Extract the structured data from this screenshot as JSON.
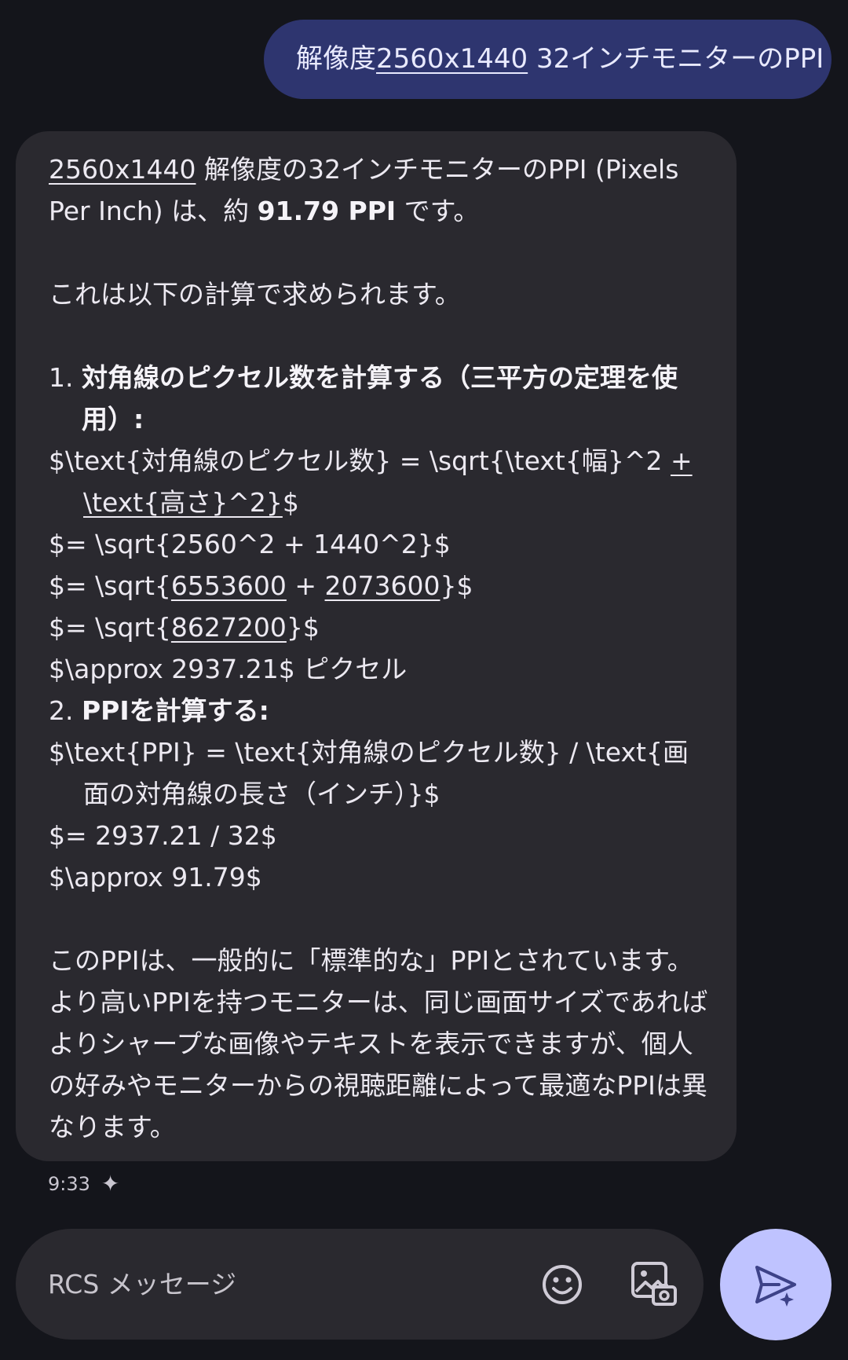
{
  "user_message": {
    "prefix": "解像度",
    "link": "2560x1440",
    "suffix": " 32インチモニターのPPI"
  },
  "ai_message": {
    "intro_link": "2560x1440",
    "intro_text1": " 解像度の32インチモニターのPPI (Pixels Per Inch) は、約 ",
    "intro_bold": "91.79 PPI",
    "intro_text2": " です。",
    "calc_intro": "これは以下の計算で求められます。",
    "step1_num": "1.",
    "step1_title": "対角線のピクセル数を計算する（三平方の定理を使用）:",
    "f1_a": "$\\text{対角線のピクセル数} = \\sqrt{\\text{幅}^2 ",
    "f1_plus": "+",
    "f1_b": "\\text{高さ}^2}",
    "f1_c": "$",
    "f2": "$= \\sqrt{2560^2 + 1440^2}$",
    "f3_a": "$= \\sqrt{",
    "f3_n1": "6553600",
    "f3_mid": " + ",
    "f3_n2": "2073600",
    "f3_end": "}$",
    "f4_a": "$= \\sqrt{",
    "f4_n": "8627200",
    "f4_end": "}$",
    "f5": "$\\approx 2937.21$ ピクセル",
    "step2_num": "2.",
    "step2_title": "PPIを計算する:",
    "f6": "$\\text{PPI} = \\text{対角線のピクセル数} / \\text{画面の対角線の長さ（インチ）}$",
    "f7": "$= 2937.21 / 32$",
    "f8": "$\\approx 91.79$",
    "conclusion": "このPPIは、一般的に「標準的な」PPIとされています。より高いPPIを持つモニターは、同じ画面サイズであればよりシャープな画像やテキストを表示できますが、個人の好みやモニターからの視聴距離によって最適なPPIは異なります。"
  },
  "timestamp": "9:33",
  "composer": {
    "placeholder": "RCS メッセージ"
  },
  "icons": {
    "sparkle": "sparkle-icon",
    "emoji": "emoji-icon",
    "gallery": "gallery-icon",
    "send": "send-icon"
  }
}
